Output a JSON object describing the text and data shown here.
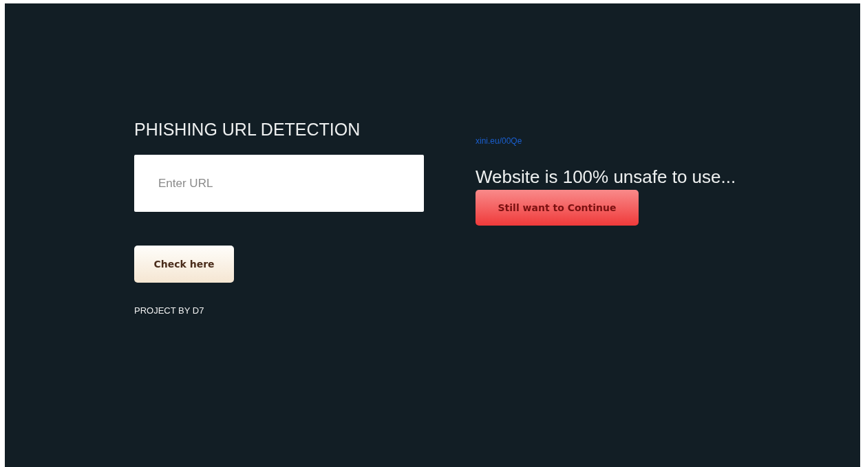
{
  "title": "PHISHING URL DETECTION",
  "url_field": {
    "placeholder": "Enter URL"
  },
  "check_button": "Check here",
  "credit": "PROJECT BY D7",
  "result": {
    "url": "xini.eu/00Qe",
    "message": "Website is 100% unsafe to use...",
    "continue_button": "Still want to Continue"
  }
}
